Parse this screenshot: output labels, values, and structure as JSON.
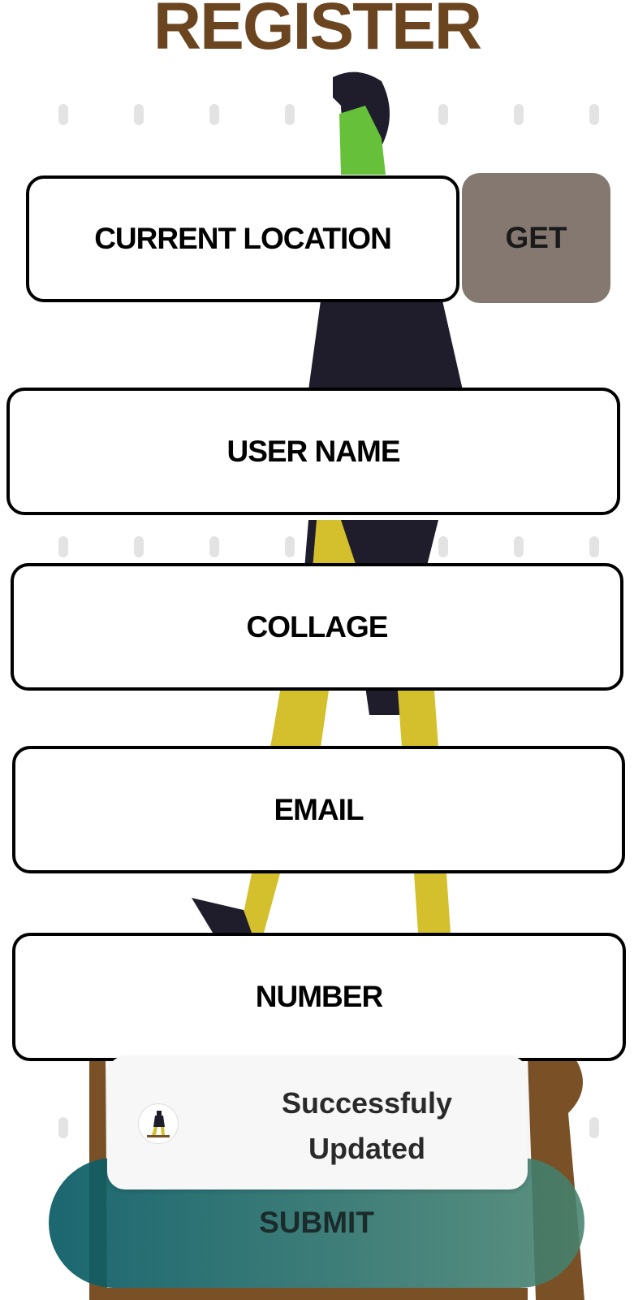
{
  "header": {
    "title": "REGISTER"
  },
  "form": {
    "current_location_label": "CURRENT LOCATION",
    "get_button_label": "GET",
    "user_name_label": "USER NAME",
    "college_label": "COLLAGE",
    "email_label": "EMAIL",
    "number_label": "NUMBER",
    "submit_label": "SUBMIT"
  },
  "toast": {
    "line1": "Successfuly",
    "line2": "Updated",
    "logo_icon": "app-logo-icon"
  },
  "colors": {
    "title": "#6b4520",
    "get_button_bg": "#857870",
    "submit_gradient_start": "#085a64",
    "submit_gradient_end": "#46826e",
    "field_border": "#000000",
    "figure_dark": "#1f1c2c",
    "figure_yellow": "#d4c02c",
    "figure_green": "#66c03a",
    "figure_brown": "#7a5126"
  }
}
